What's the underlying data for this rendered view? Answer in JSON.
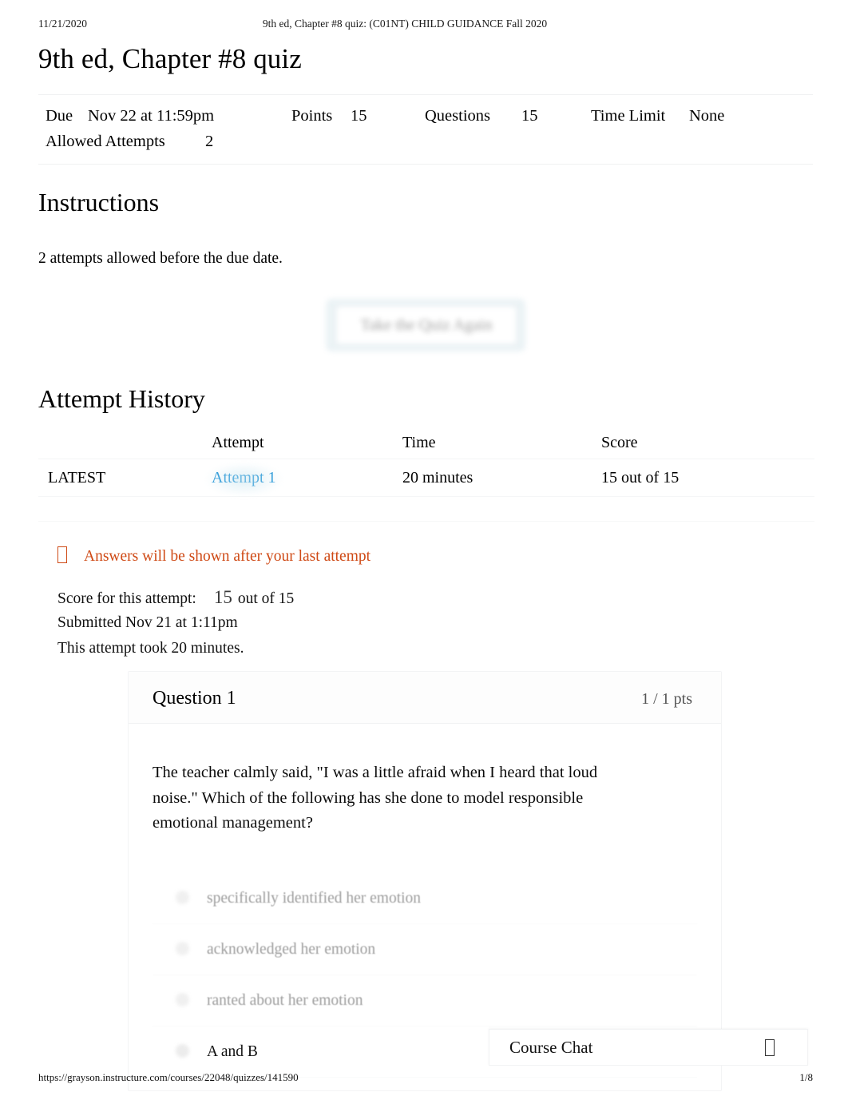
{
  "print": {
    "date": "11/21/2020",
    "document_title": "9th ed, Chapter #8 quiz: (C01NT) CHILD GUIDANCE Fall 2020",
    "footer_url": "https://grayson.instructure.com/courses/22048/quizzes/141590",
    "page_number": "1/8"
  },
  "quiz": {
    "title": "9th ed, Chapter #8 quiz",
    "details": {
      "due_label": "Due",
      "due_value": "Nov 22 at 11:59pm",
      "points_label": "Points",
      "points_value": "15",
      "questions_label": "Questions",
      "questions_value": "15",
      "time_limit_label": "Time Limit",
      "time_limit_value": "None",
      "allowed_attempts_label": "Allowed Attempts",
      "allowed_attempts_value": "2"
    }
  },
  "instructions": {
    "heading": "Instructions",
    "text": "2 attempts allowed before the due date."
  },
  "actions": {
    "retake_label": "Take the Quiz Again"
  },
  "attempt_history": {
    "heading": "Attempt History",
    "columns": [
      "",
      "Attempt",
      "Time",
      "Score"
    ],
    "rows": [
      {
        "kept": "LATEST",
        "attempt": "Attempt 1",
        "time": "20 minutes",
        "score": "15 out of 15"
      }
    ]
  },
  "notice": {
    "icon": "missing-glyph-box-icon",
    "text": "Answers will be shown after your last attempt",
    "color": "#cf4a16"
  },
  "score_summary": {
    "score_label": "Score for this attempt:",
    "score_value": "15",
    "score_out_of": "out of 15",
    "submitted": "Submitted Nov 21 at 1:11pm",
    "duration": "This attempt took 20 minutes."
  },
  "question": {
    "title": "Question 1",
    "points": "1 / 1 pts",
    "text": "The teacher calmly said, \"I was a little afraid when I heard that loud noise.\" Which of the following has she done to model responsible emotional management?",
    "answers": [
      {
        "label": "specifically identified her emotion",
        "selected": false
      },
      {
        "label": "acknowledged her emotion",
        "selected": false
      },
      {
        "label": "ranted about her emotion",
        "selected": false
      },
      {
        "label": "A and B",
        "selected": true
      }
    ]
  },
  "course_chat": {
    "label": "Course Chat",
    "toggle_icon": "missing-glyph-box-icon"
  },
  "colors": {
    "link": "#2596d8",
    "notice": "#cf4a16",
    "muted": "#9d9d9d",
    "points": "#555555"
  }
}
